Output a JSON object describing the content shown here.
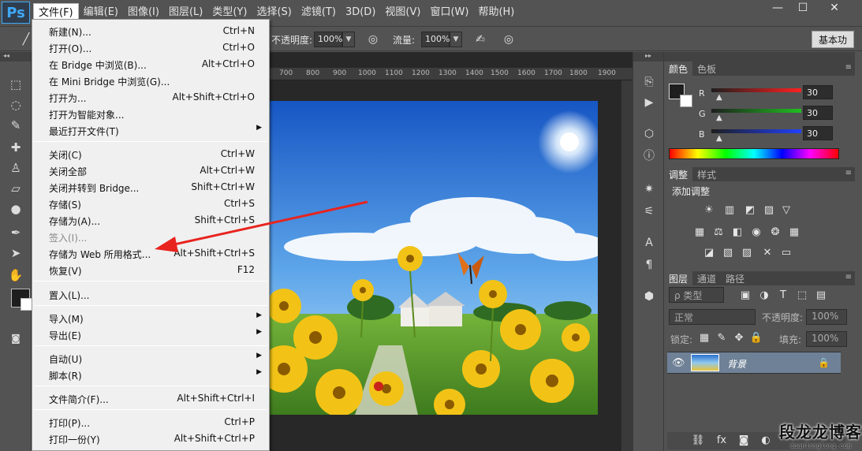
{
  "app": {
    "logo": "Ps"
  },
  "menubar": {
    "items": [
      "文件(F)",
      "编辑(E)",
      "图像(I)",
      "图层(L)",
      "类型(Y)",
      "选择(S)",
      "滤镜(T)",
      "3D(D)",
      "视图(V)",
      "窗口(W)",
      "帮助(H)"
    ],
    "active_index": 0
  },
  "window_controls": {
    "minimize": "—",
    "restore": "☐",
    "close": "✕"
  },
  "options_bar": {
    "opacity_label": "不透明度:",
    "opacity_value": "100%",
    "flow_label": "流量:",
    "flow_value": "100%",
    "workspace": "基本功"
  },
  "ruler": {
    "ticks": [
      "700",
      "800",
      "900",
      "1000",
      "1100",
      "1200",
      "1300",
      "1400",
      "1500",
      "1600",
      "1700",
      "1800",
      "1900"
    ]
  },
  "file_menu": {
    "items": [
      {
        "label": "新建(N)...",
        "shortcut": "Ctrl+N"
      },
      {
        "label": "打开(O)...",
        "shortcut": "Ctrl+O"
      },
      {
        "label": "在 Bridge 中浏览(B)...",
        "shortcut": "Alt+Ctrl+O"
      },
      {
        "label": "在 Mini Bridge 中浏览(G)...",
        "shortcut": ""
      },
      {
        "label": "打开为...",
        "shortcut": "Alt+Shift+Ctrl+O"
      },
      {
        "label": "打开为智能对象...",
        "shortcut": ""
      },
      {
        "label": "最近打开文件(T)",
        "shortcut": "",
        "submenu": true
      },
      {
        "label": "关闭(C)",
        "shortcut": "Ctrl+W"
      },
      {
        "label": "关闭全部",
        "shortcut": "Alt+Ctrl+W"
      },
      {
        "label": "关闭并转到 Bridge...",
        "shortcut": "Shift+Ctrl+W"
      },
      {
        "label": "存储(S)",
        "shortcut": "Ctrl+S"
      },
      {
        "label": "存储为(A)...",
        "shortcut": "Shift+Ctrl+S"
      },
      {
        "label": "签入(I)...",
        "shortcut": "",
        "disabled": true
      },
      {
        "label": "存储为 Web 所用格式...",
        "shortcut": "Alt+Shift+Ctrl+S"
      },
      {
        "label": "恢复(V)",
        "shortcut": "F12"
      },
      {
        "label": "置入(L)...",
        "shortcut": ""
      },
      {
        "label": "导入(M)",
        "shortcut": "",
        "submenu": true
      },
      {
        "label": "导出(E)",
        "shortcut": "",
        "submenu": true
      },
      {
        "label": "自动(U)",
        "shortcut": "",
        "submenu": true
      },
      {
        "label": "脚本(R)",
        "shortcut": "",
        "submenu": true
      },
      {
        "label": "文件简介(F)...",
        "shortcut": "Alt+Shift+Ctrl+I"
      },
      {
        "label": "打印(P)...",
        "shortcut": "Ctrl+P"
      },
      {
        "label": "打印一份(Y)",
        "shortcut": "Alt+Shift+Ctrl+P"
      }
    ]
  },
  "color_panel": {
    "tabs": [
      "颜色",
      "色板"
    ],
    "channels": [
      {
        "label": "R",
        "value": "30",
        "color": "#ff2020"
      },
      {
        "label": "G",
        "value": "30",
        "color": "#20c020"
      },
      {
        "label": "B",
        "value": "30",
        "color": "#2040ff"
      }
    ]
  },
  "adjust_panel": {
    "tabs": [
      "调整",
      "样式"
    ],
    "title": "添加调整"
  },
  "layers_panel": {
    "tabs": [
      "图层",
      "通道",
      "路径"
    ],
    "filter": "ρ 类型",
    "blend_mode": "正常",
    "opacity_label": "不透明度:",
    "opacity_value": "100%",
    "lock_label": "锁定:",
    "fill_label": "填充:",
    "fill_value": "100%",
    "layer_name": "背景"
  },
  "watermark": {
    "main": "段龙龙博客",
    "sub": "duanlonglong.com"
  },
  "colors": {
    "menu_bg": "#f0f0f0",
    "ui_bg": "#535353",
    "arrow": "#e8231e",
    "selected_layer": "#6e8196"
  }
}
